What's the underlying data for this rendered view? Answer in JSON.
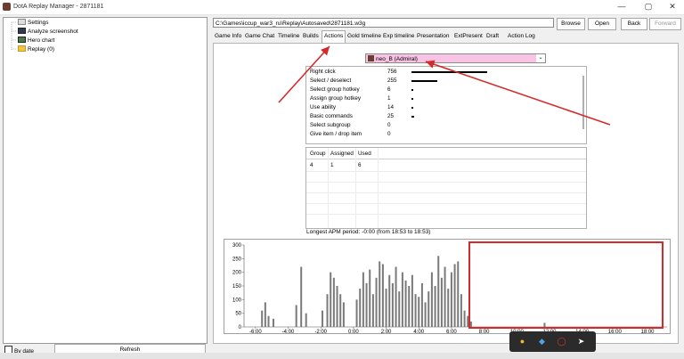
{
  "window": {
    "title": "DotA Replay Manager - 2871181",
    "controls": [
      "—",
      "▢",
      "✕"
    ]
  },
  "sidebar": {
    "items": [
      {
        "label": "Settings",
        "icon": "settings-icon"
      },
      {
        "label": "Analyze screenshot",
        "icon": "screenshot-icon"
      },
      {
        "label": "Hero chart",
        "icon": "chart-icon"
      },
      {
        "label": "Replay (0)",
        "icon": "folder-icon"
      }
    ],
    "by_date_label": "By date",
    "refresh_label": "Refresh"
  },
  "toolbar": {
    "path": "C:\\Games\\iccup_war3_ru\\Replay\\Autosaved\\2871181.w3g",
    "browse": "Browse",
    "open": "Open",
    "back": "Back",
    "forward": "Forward"
  },
  "tabs": [
    "Game Info",
    "Game Chat",
    "Timeline",
    "Builds",
    "Actions",
    "Gold timeline",
    "Exp timeline",
    "Presentation",
    "ExtPresent",
    "Draft",
    "Action Log"
  ],
  "active_tab": "Actions",
  "player": {
    "name": "neo_B (Admiral)",
    "color": "#f9c4e4"
  },
  "actions": [
    {
      "label": "Right click",
      "value": "756",
      "bar": 756
    },
    {
      "label": "Select / deselect",
      "value": "255",
      "bar": 255
    },
    {
      "label": "Select group hotkey",
      "value": "6",
      "bar": 6
    },
    {
      "label": "Assign group hotkey",
      "value": "1",
      "bar": 1
    },
    {
      "label": "Use ability",
      "value": "14",
      "bar": 14
    },
    {
      "label": "Basic commands",
      "value": "25",
      "bar": 25
    },
    {
      "label": "Select subgroup",
      "value": "0",
      "bar": 0
    },
    {
      "label": "Give item / drop item",
      "value": "0",
      "bar": 0
    }
  ],
  "groups": {
    "headers": [
      "Group",
      "Assigned",
      "Used"
    ],
    "rows": [
      [
        "4",
        "1",
        "6"
      ]
    ]
  },
  "apm_text": "Longest APM period: -0:00 (from 18:53 to 18:53)",
  "chart_data": {
    "type": "bar",
    "y_ticks": [
      "300",
      "250",
      "200",
      "150",
      "100",
      "50",
      "0"
    ],
    "ylim": [
      0,
      300
    ],
    "x_ticks": [
      "-6:00",
      "-4:00",
      "-2:00",
      "0:00",
      "2:00",
      "4:00",
      "6:00",
      "8:00",
      "10:00",
      "12:00",
      "14:00",
      "16:00",
      "18:00"
    ],
    "xlim_minutes": [
      -6.7,
      19.2
    ],
    "samples": [
      {
        "t": -5.6,
        "v": 60
      },
      {
        "t": -5.4,
        "v": 90
      },
      {
        "t": -5.2,
        "v": 40
      },
      {
        "t": -4.9,
        "v": 30
      },
      {
        "t": -3.5,
        "v": 80
      },
      {
        "t": -3.2,
        "v": 220
      },
      {
        "t": -2.9,
        "v": 50
      },
      {
        "t": -1.9,
        "v": 60
      },
      {
        "t": -1.6,
        "v": 120
      },
      {
        "t": -1.4,
        "v": 200
      },
      {
        "t": -1.2,
        "v": 180
      },
      {
        "t": -1.0,
        "v": 150
      },
      {
        "t": -0.8,
        "v": 120
      },
      {
        "t": -0.6,
        "v": 90
      },
      {
        "t": 0.2,
        "v": 100
      },
      {
        "t": 0.4,
        "v": 140
      },
      {
        "t": 0.6,
        "v": 200
      },
      {
        "t": 0.8,
        "v": 160
      },
      {
        "t": 1.0,
        "v": 210
      },
      {
        "t": 1.2,
        "v": 120
      },
      {
        "t": 1.4,
        "v": 180
      },
      {
        "t": 1.6,
        "v": 240
      },
      {
        "t": 1.8,
        "v": 230
      },
      {
        "t": 2.0,
        "v": 140
      },
      {
        "t": 2.2,
        "v": 190
      },
      {
        "t": 2.4,
        "v": 160
      },
      {
        "t": 2.6,
        "v": 220
      },
      {
        "t": 2.8,
        "v": 130
      },
      {
        "t": 3.0,
        "v": 200
      },
      {
        "t": 3.2,
        "v": 170
      },
      {
        "t": 3.4,
        "v": 150
      },
      {
        "t": 3.6,
        "v": 190
      },
      {
        "t": 3.8,
        "v": 120
      },
      {
        "t": 4.0,
        "v": 110
      },
      {
        "t": 4.2,
        "v": 160
      },
      {
        "t": 4.4,
        "v": 90
      },
      {
        "t": 4.6,
        "v": 130
      },
      {
        "t": 4.8,
        "v": 200
      },
      {
        "t": 5.0,
        "v": 150
      },
      {
        "t": 5.2,
        "v": 260
      },
      {
        "t": 5.4,
        "v": 180
      },
      {
        "t": 5.6,
        "v": 220
      },
      {
        "t": 5.8,
        "v": 140
      },
      {
        "t": 6.0,
        "v": 200
      },
      {
        "t": 6.2,
        "v": 230
      },
      {
        "t": 6.4,
        "v": 240
      },
      {
        "t": 6.6,
        "v": 120
      },
      {
        "t": 6.8,
        "v": 60
      },
      {
        "t": 7.0,
        "v": 40
      },
      {
        "t": 7.2,
        "v": 20
      },
      {
        "t": 11.7,
        "v": 15
      }
    ]
  },
  "taskbar": {
    "icons": [
      "chrome-icon",
      "vscode-icon",
      "opera-icon",
      "telegram-icon"
    ]
  },
  "colors": {
    "annotation_red": "#d42a2a",
    "bar_fill": "#7a7a7a"
  }
}
